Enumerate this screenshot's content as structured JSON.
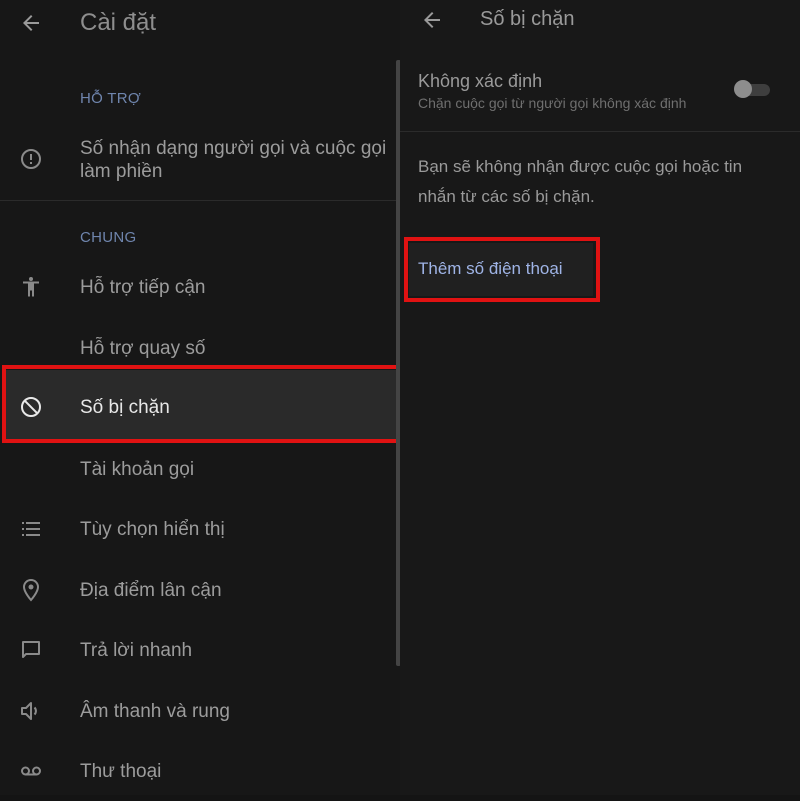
{
  "settings": {
    "title": "Cài đặt",
    "sections": {
      "support": "HỖ TRỢ",
      "general": "CHUNG"
    },
    "items": [
      {
        "label": "Số nhận dạng người gọi và cuộc gọi làm phiền",
        "icon": "alert-circle-icon"
      },
      {
        "label": "Hỗ trợ tiếp cận",
        "icon": "accessibility-icon"
      },
      {
        "label": "Hỗ trợ quay số",
        "icon": ""
      },
      {
        "label": "Số bị chặn",
        "icon": "block-icon",
        "selected": true
      },
      {
        "label": "Tài khoản gọi",
        "icon": ""
      },
      {
        "label": "Tùy chọn hiển thị",
        "icon": "list-icon"
      },
      {
        "label": "Địa điểm lân cận",
        "icon": "location-pin-icon"
      },
      {
        "label": "Trả lời nhanh",
        "icon": "message-icon"
      },
      {
        "label": "Âm thanh và rung",
        "icon": "volume-icon"
      },
      {
        "label": "Thư thoại",
        "icon": "voicemail-icon"
      }
    ]
  },
  "blocked": {
    "title": "Số bị chặn",
    "unknown": {
      "title": "Không xác định",
      "subtitle": "Chặn cuộc gọi từ người gọi không xác định",
      "enabled": false
    },
    "info": "Bạn sẽ không nhận được cuộc gọi hoặc tin nhắn từ các số bị chặn.",
    "add_button": "Thêm số điện thoại"
  },
  "colors": {
    "highlight_box": "#e01212",
    "accent_link": "#9fb4e6"
  }
}
